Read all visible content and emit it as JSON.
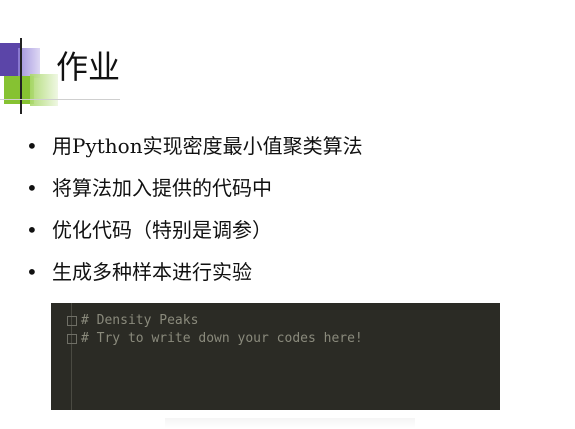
{
  "slide": {
    "title": "作业",
    "bullets": [
      "用Python实现密度最小值聚类算法",
      "将算法加入提供的代码中",
      "优化代码（特别是调参）",
      "生成多种样本进行实验"
    ],
    "bullet_symbol": "•"
  },
  "code_panel": {
    "lines": [
      "# Density Peaks",
      "# Try to write down your codes here!"
    ],
    "background": "#2b2b25",
    "text_color": "#8a8a7c"
  },
  "colors": {
    "accent_purple": "#5b45a8",
    "accent_green": "#86c232"
  }
}
